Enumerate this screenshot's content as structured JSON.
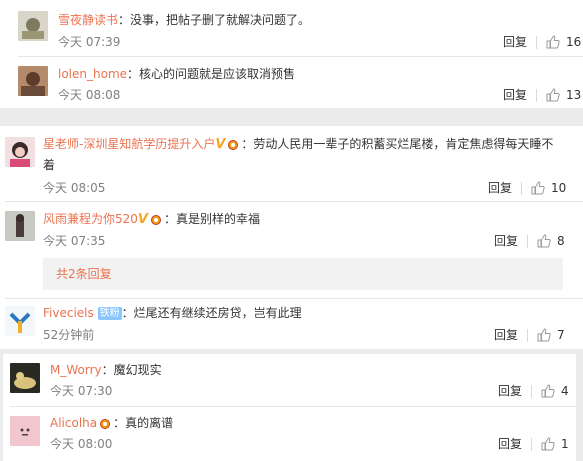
{
  "reply_label": "回复",
  "colors": {
    "name": "#eb7350",
    "meta": "#808080",
    "bg": "#ebebeb"
  },
  "group1": {
    "c1": {
      "username": "雪夜静读书",
      "text": "：没事，把帖子删了就解决问题了。",
      "time": "今天 07:39",
      "likes": "16"
    },
    "c2": {
      "username": "lolen_home",
      "text": "：核心的问题就是应该取消预售",
      "time": "今天 08:08",
      "likes": "13"
    }
  },
  "group2": {
    "c1": {
      "username": "星老师-深圳星知航学历提升入户",
      "text_line1": "：劳动人民用一辈子的积蓄买烂尾楼，肯定焦虑得每天睡不",
      "text_line2": "着",
      "time": "今天 08:05",
      "likes": "10"
    },
    "c2": {
      "username": "风雨兼程为你520",
      "text": "：真是别样的幸福",
      "time": "今天 07:35",
      "likes": "8"
    },
    "more_replies": "共2条回复",
    "c3": {
      "username": "Fiveciels",
      "fan_badge": "铁粉",
      "text": "：烂尾还有继续还房贷，岂有此理",
      "time": "52分钟前",
      "likes": "7"
    }
  },
  "group3": {
    "c1": {
      "username": "M_Worry",
      "text": "：魔幻现实",
      "time": "今天 07:30",
      "likes": "4"
    },
    "c2": {
      "username": "Alicolha",
      "text": "：真的离谱",
      "time": "今天 08:00",
      "likes": "1"
    }
  }
}
